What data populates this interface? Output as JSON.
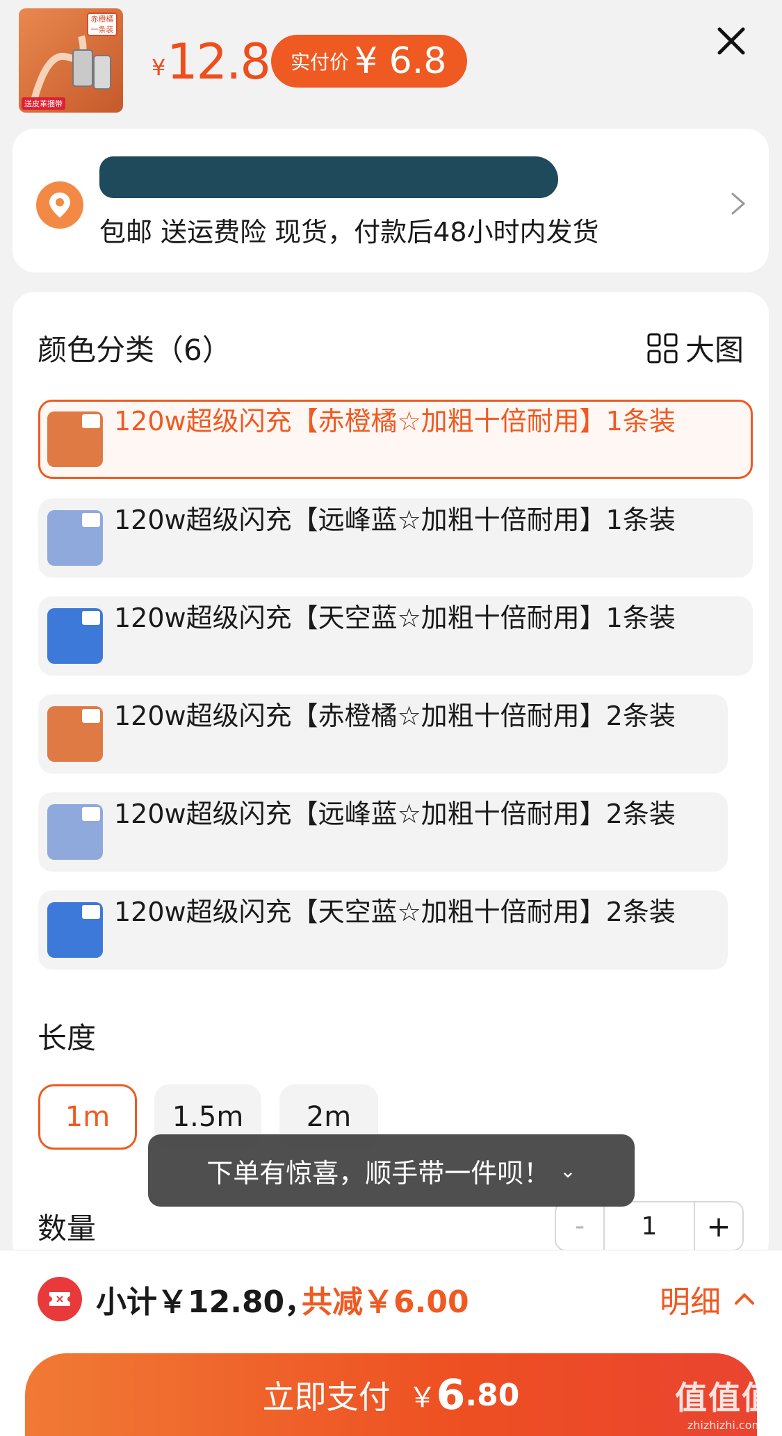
{
  "header": {
    "thumb_tag": "赤橙橘 一条装",
    "thumb_bottom": "送皮革捆带",
    "price_symbol": "¥",
    "price": "12.8",
    "pay_badge_label": "实付价",
    "pay_badge_amount": "¥ 6.8"
  },
  "address": {
    "shipping_info": "包邮  送运费险  现货，付款后48小时内发货"
  },
  "color_section": {
    "title": "颜色分类（6）",
    "big_picture_label": "大图",
    "options": [
      {
        "label": "120w超级闪充【赤橙橘☆加粗十倍耐用】1条装",
        "color": "#e07a45",
        "selected": true
      },
      {
        "label": "120w超级闪充【远峰蓝☆加粗十倍耐用】1条装",
        "color": "#8fa9dc",
        "selected": false
      },
      {
        "label": "120w超级闪充【天空蓝☆加粗十倍耐用】1条装",
        "color": "#3d79d8",
        "selected": false
      },
      {
        "label": "120w超级闪充【赤橙橘☆加粗十倍耐用】2条装",
        "color": "#e07a45",
        "selected": false
      },
      {
        "label": "120w超级闪充【远峰蓝☆加粗十倍耐用】2条装",
        "color": "#8fa9dc",
        "selected": false
      },
      {
        "label": "120w超级闪充【天空蓝☆加粗十倍耐用】2条装",
        "color": "#3d79d8",
        "selected": false
      }
    ]
  },
  "length_section": {
    "title": "长度",
    "options": [
      "1m",
      "1.5m",
      "2m"
    ],
    "selected": "1m"
  },
  "quantity_section": {
    "title": "数量",
    "minus": "-",
    "value": "1",
    "plus": "+"
  },
  "toast": {
    "text": "下单有惊喜，顺手带一件呗！",
    "chevron": "⌄"
  },
  "bottom": {
    "subtotal": "小计￥12.80，",
    "discount": "共减￥6.00",
    "detail_label": "明细",
    "pay_label": "立即支付",
    "pay_yen": "￥",
    "pay_int": "6",
    "pay_dec": ".80"
  },
  "watermark": {
    "main": "值值值",
    "sub": "zhizhizhi.com"
  },
  "colors": {
    "accent": "#ef5a22",
    "redact": "#1f4a5c"
  }
}
